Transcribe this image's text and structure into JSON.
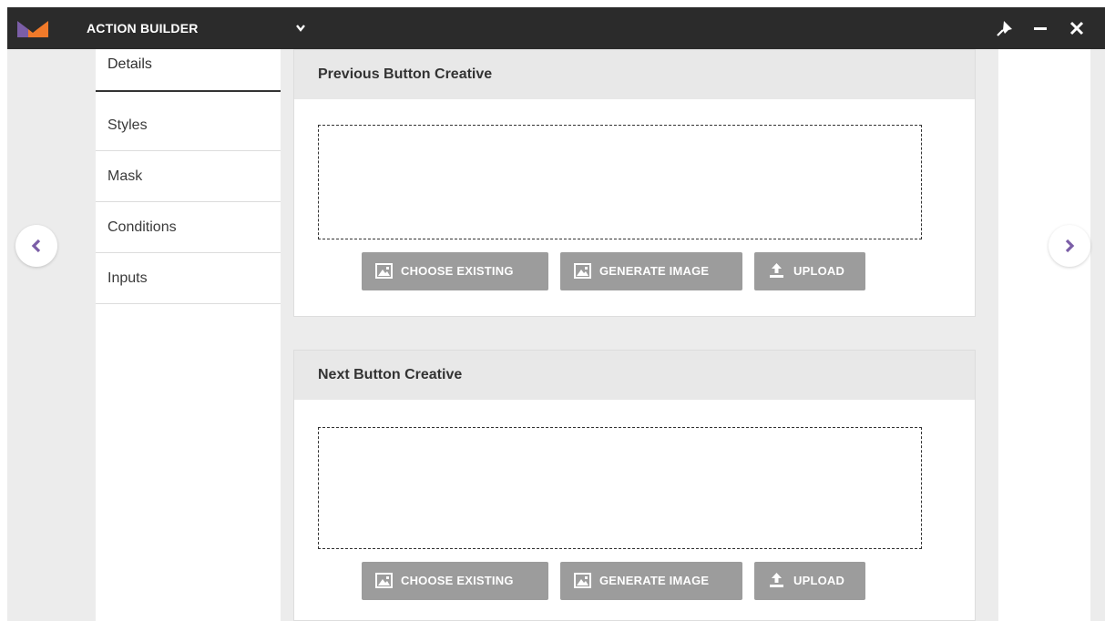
{
  "app": {
    "title": "ACTION BUILDER",
    "brand_colors": {
      "left": "#7b5ea7",
      "right": "#f07a2a"
    }
  },
  "window_controls": [
    "pin-icon",
    "minimize-icon",
    "close-icon"
  ],
  "sidebar": {
    "items": [
      {
        "label": "Details",
        "active": true
      },
      {
        "label": "Styles",
        "active": false
      },
      {
        "label": "Mask",
        "active": false
      },
      {
        "label": "Conditions",
        "active": false
      },
      {
        "label": "Inputs",
        "active": false
      }
    ]
  },
  "cards": [
    {
      "title": "Previous Button Creative",
      "buttons": {
        "choose": "CHOOSE EXISTING",
        "generate": "GENERATE IMAGE",
        "upload": "UPLOAD"
      }
    },
    {
      "title": "Next Button Creative",
      "buttons": {
        "choose": "CHOOSE EXISTING",
        "generate": "GENERATE IMAGE",
        "upload": "UPLOAD"
      }
    }
  ],
  "colors": {
    "titlebar": "#2b2b2b",
    "button": "#9c9c9c",
    "arrow_accent": "#7b5ea7"
  }
}
